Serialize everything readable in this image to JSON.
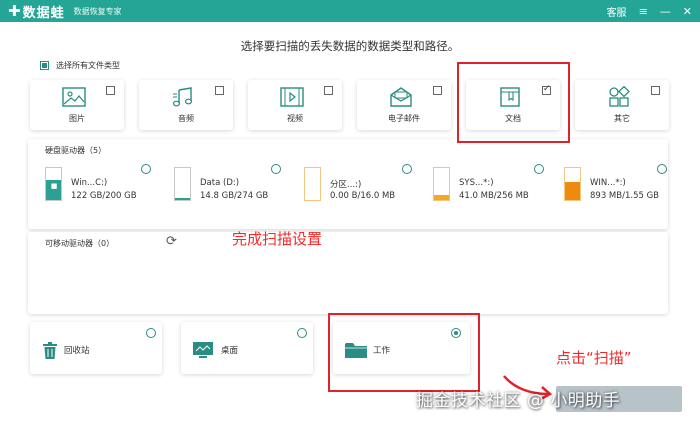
{
  "titlebar": {
    "logo_cross": "✚",
    "app_name": "数据蛙",
    "app_subtitle": "数据恢复专家",
    "service_label": "客服",
    "menu_icon": "≡",
    "minimize_icon": "—",
    "close_icon": "✕"
  },
  "subtitle": "选择要扫描的丢失数据的数据类型和路径。",
  "select_all_label": "选择所有文件类型",
  "file_types": [
    {
      "label": "图片",
      "icon": "image-icon",
      "checked": false
    },
    {
      "label": "音频",
      "icon": "music-icon",
      "checked": false
    },
    {
      "label": "视频",
      "icon": "video-icon",
      "checked": false
    },
    {
      "label": "电子邮件",
      "icon": "email-icon",
      "checked": false
    },
    {
      "label": "文档",
      "icon": "document-icon",
      "checked": true
    },
    {
      "label": "其它",
      "icon": "other-icon",
      "checked": false
    }
  ],
  "hard_drives": {
    "title": "硬盘驱动器（5）",
    "items": [
      {
        "name": "Win...C:)",
        "size": "122 GB/200 GB",
        "fill_fraction": 0.61,
        "color": "#2aa192"
      },
      {
        "name": "Data (D:)",
        "size": "14.8 GB/274 GB",
        "fill_fraction": 0.05,
        "color": "#2aa192"
      },
      {
        "name": "分区...:)",
        "size": "0.00  B/16.0 MB",
        "fill_fraction": 0.0,
        "color": "#f5a623"
      },
      {
        "name": "SYS...*:)",
        "size": "41.0 MB/256 MB",
        "fill_fraction": 0.16,
        "color": "#f5a623"
      },
      {
        "name": "WIN...*:)",
        "size": "893 MB/1.55 GB",
        "fill_fraction": 0.56,
        "color": "#f08a0f"
      }
    ]
  },
  "removable": {
    "title": "可移动驱动器（0）",
    "refresh_icon": "⟳"
  },
  "locations": [
    {
      "label": "回收站",
      "icon": "trash-icon",
      "selected": false
    },
    {
      "label": "桌面",
      "icon": "desktop-icon",
      "selected": false
    },
    {
      "label": "工作",
      "icon": "folder-icon",
      "selected": true
    }
  ],
  "annotations": {
    "complete_settings": "完成扫描设置",
    "click_scan": "点击“扫描”"
  },
  "watermark": "掘金技术社区 @ 小明助手",
  "colors": {
    "accent": "#25a596",
    "annotation_red": "#e0222a"
  }
}
